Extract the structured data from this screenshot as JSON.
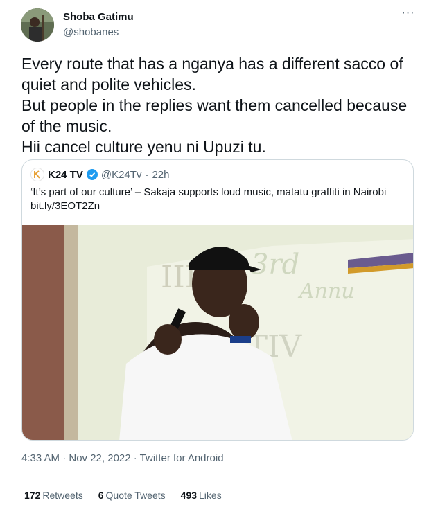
{
  "author": {
    "display_name": "Shoba Gatimu",
    "handle": "@shobanes",
    "avatar_icon": "profile-photo"
  },
  "tweet": {
    "text": "Every route that has a nganya has a different sacco of\nquiet and polite vehicles.\nBut people in the replies want them cancelled because\nof the music.\nHii cancel culture yenu ni Upuzi tu."
  },
  "more_menu_label": "···",
  "quoted_tweet": {
    "display_name": "K24 TV",
    "handle": "@K24Tv",
    "separator": "·",
    "time": "22h",
    "text": "‘It’s part of our culture’ – Sakaja supports loud music, matatu graffiti in Nairobi",
    "link": "bit.ly/3EOT2Zn",
    "photo_description_icon": "news-photo"
  },
  "meta": {
    "timestamp": "4:33 AM · Nov 22, 2022 · Twitter for Android"
  },
  "stats": {
    "retweets_count": "172",
    "retweets_label": "Retweets",
    "quotes_count": "6",
    "quotes_label": "Quote Tweets",
    "likes_count": "493",
    "likes_label": "Likes"
  },
  "colors": {
    "text": "#0f1419",
    "secondary": "#536471",
    "verified": "#1d9bf0",
    "border": "#cfd9de"
  }
}
